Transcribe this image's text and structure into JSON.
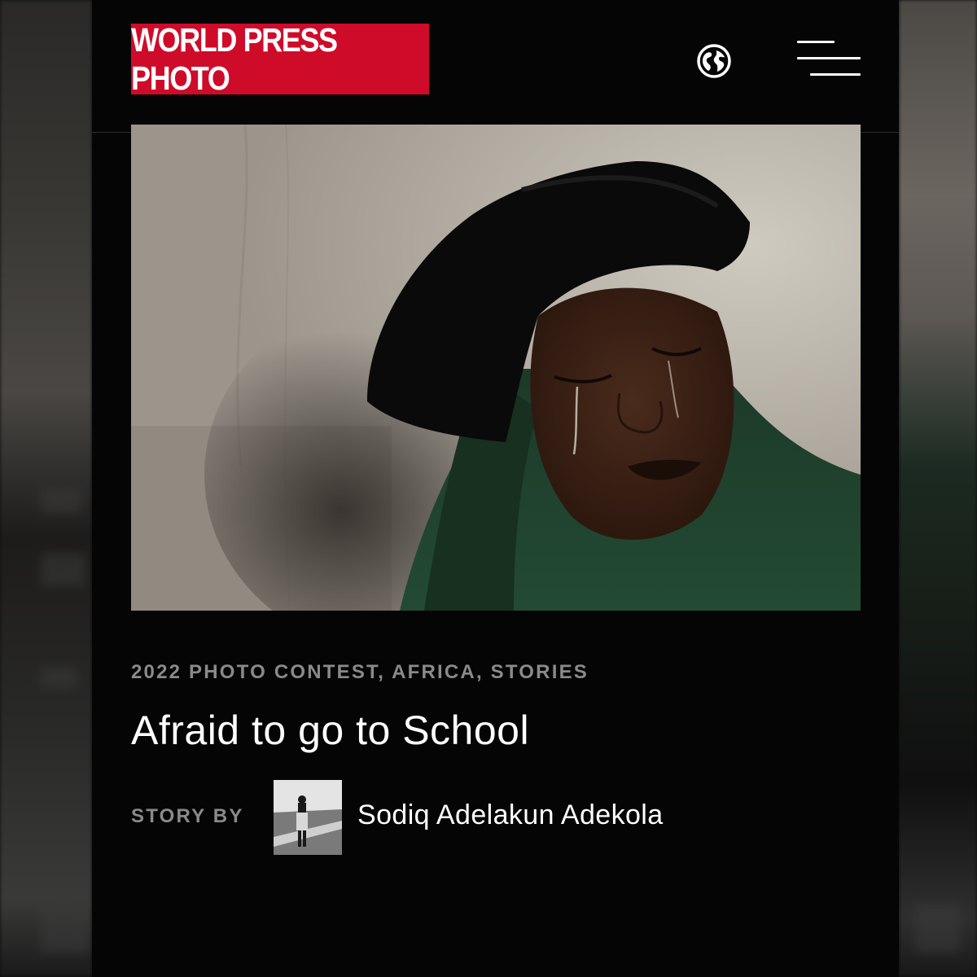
{
  "header": {
    "logo_text": "WORLD PRESS PHOTO",
    "brand_color": "#cf0b2a",
    "language_icon": "globe-icon",
    "menu_icon": "hamburger-menu-icon"
  },
  "article": {
    "categories": "2022 PHOTO CONTEST, AFRICA, STORIES",
    "title": "Afraid to go to School",
    "story_by_label": "STORY BY",
    "author": "Sodiq Adelakun Adekola"
  }
}
